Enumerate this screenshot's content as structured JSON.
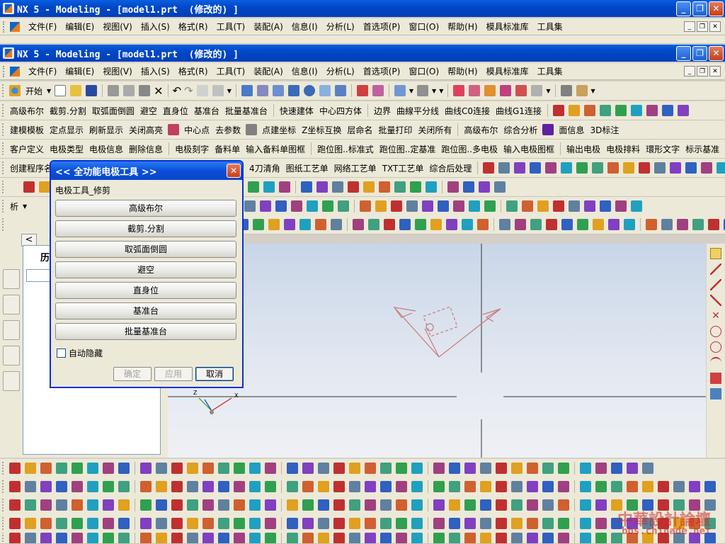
{
  "window_back": {
    "title": "NX 5 - Modeling - [model1.prt  (修改的) ]"
  },
  "window_front": {
    "title": "NX 5 - Modeling - [model1.prt  (修改的) ]"
  },
  "menus": [
    "文件(F)",
    "编辑(E)",
    "视图(V)",
    "插入(S)",
    "格式(R)",
    "工具(T)",
    "装配(A)",
    "信息(I)",
    "分析(L)",
    "首选项(P)",
    "窗口(O)",
    "帮助(H)",
    "模具标准库",
    "工具集"
  ],
  "standard_toolbar": {
    "start_label": "开始"
  },
  "toolbar_row1": [
    "高级布尔",
    "截剪.分割",
    "取弧面倒圆",
    "避空",
    "直身位",
    "基准台",
    "批量基准台",
    "快速建体",
    "中心四方体",
    "边界",
    "曲線平分线",
    "曲线C0连接",
    "曲线G1连接"
  ],
  "toolbar_row2": [
    "建模模板",
    "定点显示",
    "刷新显示",
    "关闭高亮",
    "中心点",
    "去参数",
    "点建坐标",
    "Z坐标互换",
    "层命名",
    "批量打印",
    "关闭所有",
    "高级布尔",
    "综合分析",
    "面信息",
    "3D标注"
  ],
  "toolbar_row3": [
    "客户定义",
    "电极类型",
    "电极信息",
    "删除信息",
    "电极刻字",
    "备料单",
    "输入备料单图框",
    "跑位图..标准式",
    "跑位图..定基准",
    "跑位图..多电极",
    "输入电极图框",
    "输出电极",
    "电极排料",
    "環形文字",
    "标示基准"
  ],
  "toolbar_row4": [
    "创建程序名",
    "4刀清角",
    "图纸工艺单",
    "网络工艺单",
    "TXT工艺单",
    "综合后处理"
  ],
  "toolbar_row5": {
    "label": "析"
  },
  "resource_bar": {
    "label": "历"
  },
  "dialog": {
    "title": "<< 全功能电极工具 >>",
    "group_label": "电极工具_修剪",
    "buttons": [
      "高级布尔",
      "截剪.分割",
      "取弧面倒圆",
      "避空",
      "直身位",
      "基准台",
      "批量基准台"
    ],
    "auto_hide": "自动隐藏",
    "ok": "确定",
    "apply": "应用",
    "cancel": "取消"
  },
  "viewport": {
    "triad_z": "Z",
    "triad_x": "X"
  },
  "watermark": {
    "line1": "中華設計論壇",
    "line2": "bbs.chinade.net"
  }
}
